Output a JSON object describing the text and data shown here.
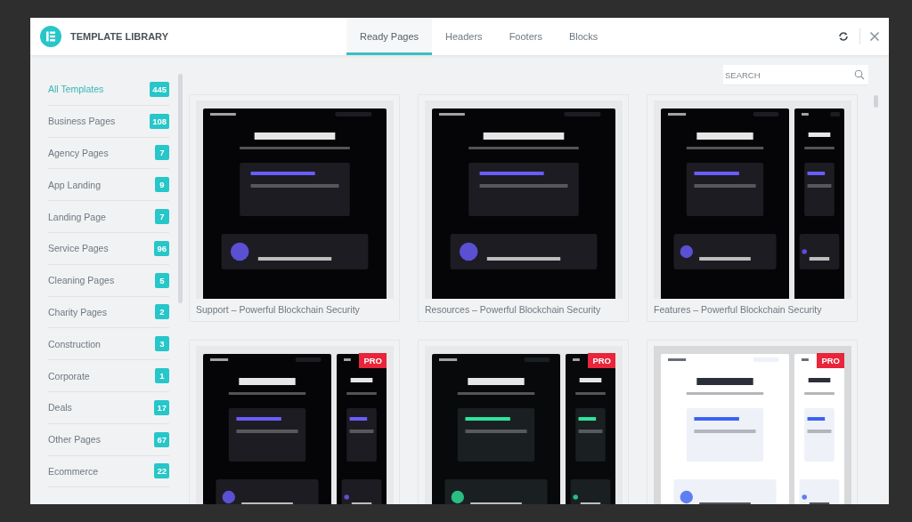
{
  "header": {
    "title": "TEMPLATE LIBRARY"
  },
  "tabs": [
    {
      "label": "Ready Pages",
      "selected": true
    },
    {
      "label": "Headers",
      "selected": false
    },
    {
      "label": "Footers",
      "selected": false
    },
    {
      "label": "Blocks",
      "selected": false
    }
  ],
  "search": {
    "placeholder": "SEARCH"
  },
  "categories": [
    {
      "label": "All Templates",
      "count": "445",
      "selected": true
    },
    {
      "label": "Business Pages",
      "count": "108",
      "selected": false
    },
    {
      "label": "Agency Pages",
      "count": "7",
      "selected": false
    },
    {
      "label": "App Landing",
      "count": "9",
      "selected": false
    },
    {
      "label": "Landing Page",
      "count": "7",
      "selected": false
    },
    {
      "label": "Service Pages",
      "count": "96",
      "selected": false
    },
    {
      "label": "Cleaning Pages",
      "count": "5",
      "selected": false
    },
    {
      "label": "Charity Pages",
      "count": "2",
      "selected": false
    },
    {
      "label": "Construction",
      "count": "3",
      "selected": false
    },
    {
      "label": "Corporate",
      "count": "1",
      "selected": false
    },
    {
      "label": "Deals",
      "count": "17",
      "selected": false
    },
    {
      "label": "Other Pages",
      "count": "67",
      "selected": false
    },
    {
      "label": "Ecommerce",
      "count": "22",
      "selected": false
    }
  ],
  "templates": [
    {
      "title": "Support – Powerful Blockchain Security",
      "kind": "picture"
    },
    {
      "title": "Resources – Powerful Blockchain Security",
      "kind": "picture"
    },
    {
      "title": "Features – Powerful Blockchain Security",
      "kind": "picture"
    },
    {
      "badge": "PRO",
      "kind": "picture"
    },
    {
      "badge": "PRO",
      "kind": "picture"
    },
    {
      "badge": "PRO",
      "kind": "picture"
    }
  ]
}
